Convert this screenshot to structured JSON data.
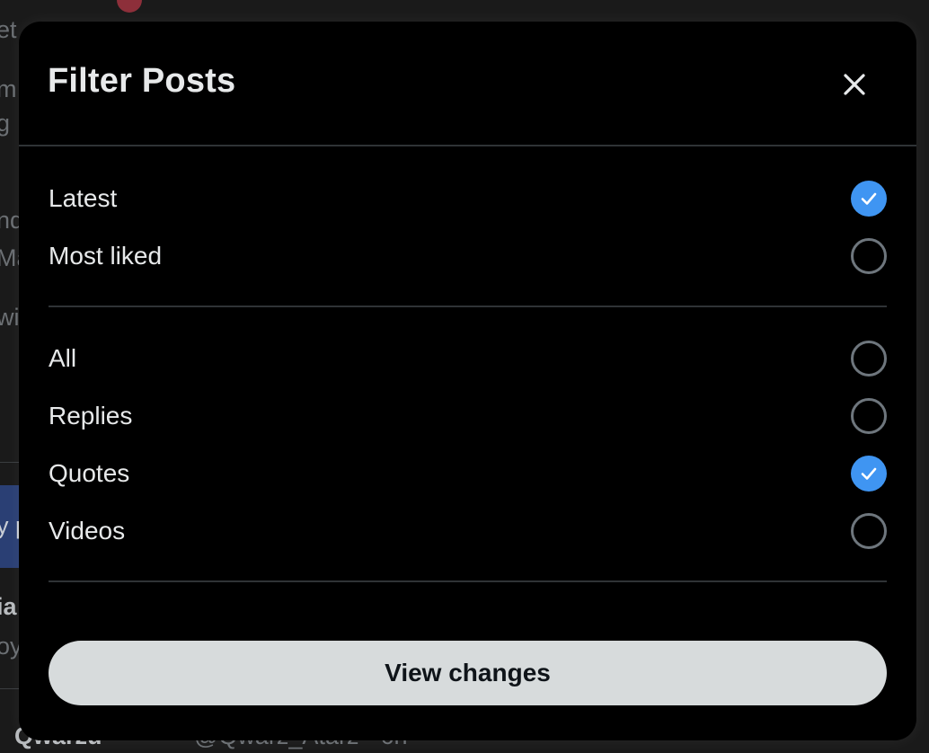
{
  "background": {
    "fragments": [
      "et",
      "m",
      "g",
      "nd",
      "Ma",
      "wi",
      "y p",
      "ia",
      "oy"
    ],
    "bottom_name": "Qwarzu",
    "bottom_handle": "@Qwarz_Atarz · 6h"
  },
  "modal": {
    "title": "Filter Posts",
    "close_icon": "close-icon",
    "sort_options": [
      {
        "label": "Latest",
        "checked": true
      },
      {
        "label": "Most liked",
        "checked": false
      }
    ],
    "type_options": [
      {
        "label": "All",
        "checked": false
      },
      {
        "label": "Replies",
        "checked": false
      },
      {
        "label": "Quotes",
        "checked": true
      },
      {
        "label": "Videos",
        "checked": false
      }
    ],
    "submit_label": "View changes"
  },
  "colors": {
    "accent": "#3f95f2",
    "modal_bg": "#000000",
    "button_bg": "#d7dbdc",
    "divider": "#2f3336"
  }
}
